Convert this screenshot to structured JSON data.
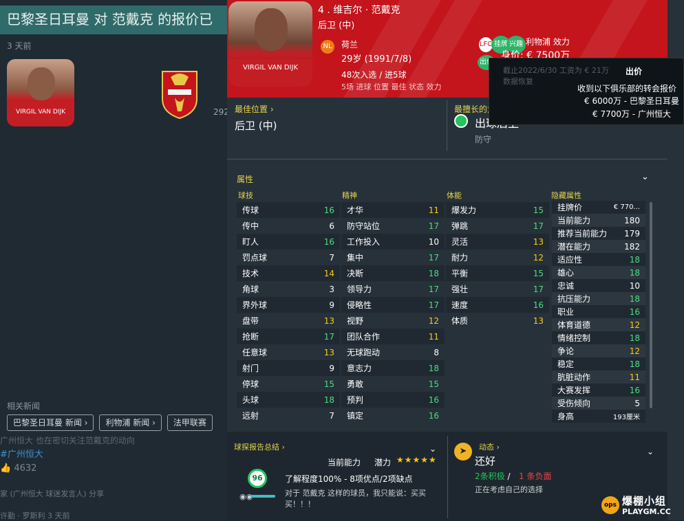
{
  "news": {
    "title": "巴黎圣日耳曼 对 范戴克 的报价已",
    "time": "3 天前",
    "crest_count": "292",
    "related_label": "相关新闻",
    "chips": [
      "巴黎圣日耳曼 新闻 ›",
      "利物浦 新闻 ›",
      "法甲联赛"
    ],
    "blur_line": "广州恒大 也在密切关注范戴克的动向",
    "blur_link": "#广州恒大",
    "likes": "4632",
    "share": "家 (广州恒大 球迷发言人) 分享",
    "author": "许勤 · 罗斯利",
    "author_time": "3 天前"
  },
  "player": {
    "name": "4 . 维吉尔 · 范戴克",
    "position": "后卫 (中)",
    "nationality": "荷兰",
    "age": "29岁 (1991/7/8)",
    "caps": "48次入选 / 进5球",
    "header_blur": "5场 进球 位置 最佳 状态 效力",
    "club": "利物浦 效力",
    "value": "身价: € 7500万",
    "tags": [
      "挂牌",
      "兴趣",
      "出价"
    ],
    "best_position_label": "最佳位置 ›",
    "best_position": "后卫 (中)",
    "role_label": "最擅长的角色和职责 ›",
    "role": "出球后卫",
    "role_duty": "防守"
  },
  "attributes": {
    "label": "属性",
    "technical_label": "球技",
    "mental_label": "精神",
    "physical_label": "体能",
    "hidden_label": "隐藏属性",
    "technical": [
      {
        "name": "传球",
        "value": "16"
      },
      {
        "name": "传中",
        "value": "6"
      },
      {
        "name": "盯人",
        "value": "16"
      },
      {
        "name": "罚点球",
        "value": "7"
      },
      {
        "name": "技术",
        "value": "14"
      },
      {
        "name": "角球",
        "value": "3"
      },
      {
        "name": "界外球",
        "value": "9"
      },
      {
        "name": "盘带",
        "value": "13"
      },
      {
        "name": "抢断",
        "value": "17"
      },
      {
        "name": "任意球",
        "value": "13"
      },
      {
        "name": "射门",
        "value": "9"
      },
      {
        "name": "停球",
        "value": "15"
      },
      {
        "name": "头球",
        "value": "18"
      },
      {
        "name": "远射",
        "value": "7"
      }
    ],
    "mental": [
      {
        "name": "才华",
        "value": "11"
      },
      {
        "name": "防守站位",
        "value": "17"
      },
      {
        "name": "工作投入",
        "value": "10"
      },
      {
        "name": "集中",
        "value": "17"
      },
      {
        "name": "决断",
        "value": "18"
      },
      {
        "name": "领导力",
        "value": "17"
      },
      {
        "name": "侵略性",
        "value": "17"
      },
      {
        "name": "视野",
        "value": "12"
      },
      {
        "name": "团队合作",
        "value": "11"
      },
      {
        "name": "无球跑动",
        "value": "8"
      },
      {
        "name": "意志力",
        "value": "18"
      },
      {
        "name": "勇敢",
        "value": "15"
      },
      {
        "name": "预判",
        "value": "16"
      },
      {
        "name": "镇定",
        "value": "16"
      }
    ],
    "physical": [
      {
        "name": "爆发力",
        "value": "15"
      },
      {
        "name": "弹跳",
        "value": "17"
      },
      {
        "name": "灵活",
        "value": "13"
      },
      {
        "name": "耐力",
        "value": "12"
      },
      {
        "name": "平衡",
        "value": "15"
      },
      {
        "name": "强壮",
        "value": "17"
      },
      {
        "name": "速度",
        "value": "16"
      },
      {
        "name": "体质",
        "value": "13"
      }
    ],
    "hidden": [
      {
        "name": "挂牌价",
        "value": "€ 770..."
      },
      {
        "name": "当前能力",
        "value": "180"
      },
      {
        "name": "推荐当前能力",
        "value": "179"
      },
      {
        "name": "潜在能力",
        "value": "182"
      },
      {
        "name": "适应性",
        "value": "18"
      },
      {
        "name": "雄心",
        "value": "18"
      },
      {
        "name": "忠诚",
        "value": "10"
      },
      {
        "name": "抗压能力",
        "value": "18"
      },
      {
        "name": "职业",
        "value": "16"
      },
      {
        "name": "体育道德",
        "value": "12"
      },
      {
        "name": "情绪控制",
        "value": "18"
      },
      {
        "name": "争论",
        "value": "12"
      },
      {
        "name": "稳定",
        "value": "18"
      },
      {
        "name": "肮脏动作",
        "value": "11"
      },
      {
        "name": "大赛发挥",
        "value": "16"
      },
      {
        "name": "受伤倾向",
        "value": "5"
      },
      {
        "name": "身高",
        "value": "193厘米"
      }
    ]
  },
  "report": {
    "label": "球探报告总结 ›",
    "current_ability": "当前能力",
    "potential": "潜力",
    "stars": "★★★★★",
    "score": "96",
    "knowledge": "了解程度100% - 8项优点/2项缺点",
    "quote": "对于 范戴克 这样的球员，我只能说：买买买！！！"
  },
  "dynamics": {
    "label": "动态 ›",
    "value": "还好",
    "positive": "2条积极",
    "separator": "/",
    "negative": "1 条负面",
    "note": "正在考虑自己的选择"
  },
  "tooltip": {
    "title": "出价",
    "desc": "收到以下俱乐部的转会报价",
    "offer1": "€ 6000万 - 巴黎圣日耳曼",
    "offer2": "€ 7700万 - 广州恒大",
    "blur": "截止2022/6/30 工资为 € 21万\n数据恢复"
  },
  "watermark": {
    "logo": "ops",
    "line1": "爆棚小组",
    "line2": "PLAYGM.CC"
  },
  "colors": {
    "header_red": "#c4141c",
    "accent_yellow": "#e5d54a",
    "high_green": "#22c55e",
    "mid_yellow": "#eab308"
  }
}
